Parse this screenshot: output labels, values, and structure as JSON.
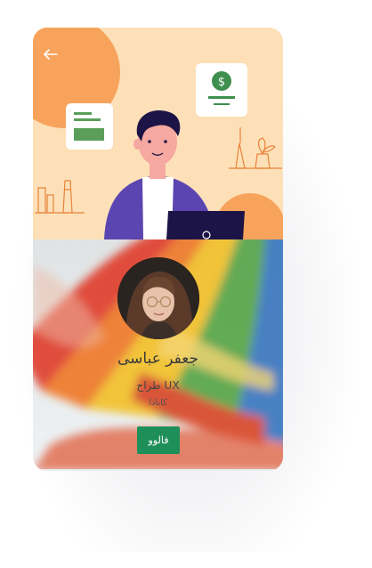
{
  "profile": {
    "name": "جعفر عباسی",
    "role": "UX طراح",
    "location": "کانادا",
    "follow_label": "فالوو"
  },
  "icons": {
    "back": "arrow-left-icon",
    "dollar": "dollar-sign-icon"
  },
  "colors": {
    "hero_bg": "#fde0b8",
    "accent_orange": "#f7a35c",
    "follow_button": "#1f8f5a",
    "jacket": "#5b45b0"
  }
}
